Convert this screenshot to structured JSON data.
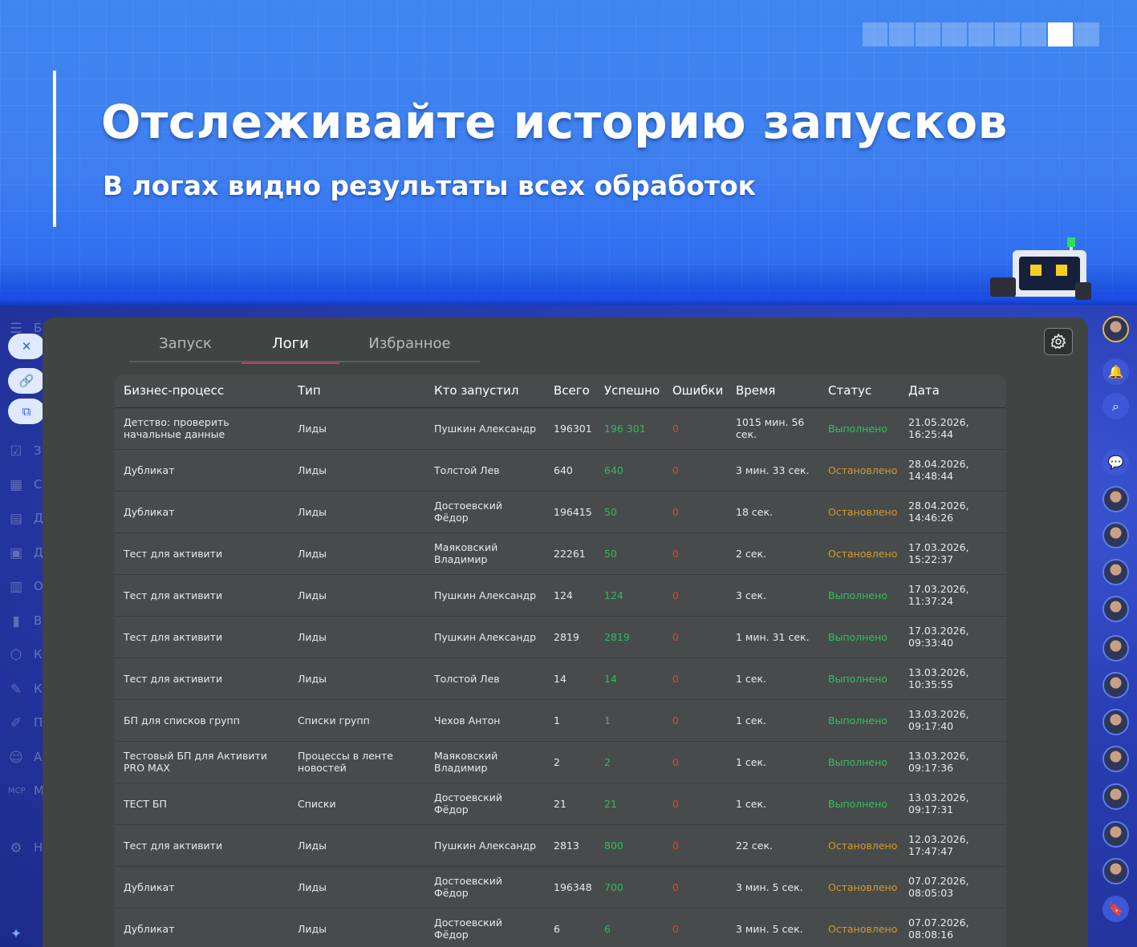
{
  "banner": {
    "title": "Отслеживайте историю запусков",
    "subtitle": "В логах видно результаты всех обработок",
    "page_dots": {
      "total": 9,
      "active_index": 7
    }
  },
  "tabs": [
    {
      "label": "Запуск",
      "active": false
    },
    {
      "label": "Логи",
      "active": true
    },
    {
      "label": "Избранное",
      "active": false
    }
  ],
  "table": {
    "columns": [
      "Бизнес-процесс",
      "Тип",
      "Кто запустил",
      "Всего",
      "Успешно",
      "Ошибки",
      "Время",
      "Статус",
      "Дата"
    ],
    "rows": [
      [
        "Детство: проверить начальные данные",
        "Лиды",
        "Пушкин Александр",
        "196301",
        "196 301",
        "0",
        "1015 мин. 56 сек.",
        "Выполнено",
        "21.05.2026, 16:25:44"
      ],
      [
        "Дубликат",
        "Лиды",
        "Толстой Лев",
        "640",
        "640",
        "0",
        "3 мин. 33 сек.",
        "Остановлено",
        "28.04.2026, 14:48:44"
      ],
      [
        "Дубликат",
        "Лиды",
        "Достоевский Фёдор",
        "196415",
        "50",
        "0",
        "18 сек.",
        "Остановлено",
        "28.04.2026, 14:46:26"
      ],
      [
        "Тест для активити",
        "Лиды",
        "Маяковский Владимир",
        "22261",
        "50",
        "0",
        "2 сек.",
        "Остановлено",
        "17.03.2026, 15:22:37"
      ],
      [
        "Тест для активити",
        "Лиды",
        "Пушкин Александр",
        "124",
        "124",
        "0",
        "3 сек.",
        "Выполнено",
        "17.03.2026, 11:37:24"
      ],
      [
        "Тест для активити",
        "Лиды",
        "Пушкин Александр",
        "2819",
        "2819",
        "0",
        "1 мин. 31 сек.",
        "Выполнено",
        "17.03.2026, 09:33:40"
      ],
      [
        "Тест для активити",
        "Лиды",
        "Толстой Лев",
        "14",
        "14",
        "0",
        "1 сек.",
        "Выполнено",
        "13.03.2026, 10:35:55"
      ],
      [
        "БП для списков групп",
        "Списки групп",
        "Чехов Антон",
        "1",
        "1",
        "0",
        "1 сек.",
        "Выполнено",
        "13.03.2026, 09:17:40"
      ],
      [
        "Тестовый БП для Активити PRO MAX",
        "Процессы в ленте новостей",
        "Маяковский Владимир",
        "2",
        "2",
        "0",
        "1 сек.",
        "Выполнено",
        "13.03.2026, 09:17:36"
      ],
      [
        "ТЕСТ БП",
        "Списки",
        "Достоевский Фёдор",
        "21",
        "21",
        "0",
        "1 сек.",
        "Выполнено",
        "13.03.2026, 09:17:31"
      ],
      [
        "Тест для активити",
        "Лиды",
        "Пушкин Александр",
        "2813",
        "800",
        "0",
        "22 сек.",
        "Остановлено",
        "12.03.2026, 17:47:47"
      ],
      [
        "Дубликат",
        "Лиды",
        "Достоевский Фёдор",
        "196348",
        "700",
        "0",
        "3 мин. 5 сек.",
        "Остановлено",
        "07.07.2026, 08:05:03"
      ],
      [
        "Дубликат",
        "Лиды",
        "Достоевский Фёдор",
        "6",
        "6",
        "0",
        "3 мин. 5 сек.",
        "Остановлено",
        "07.07.2026, 08:08:16"
      ]
    ]
  },
  "left_nav_letters": [
    "Б",
    "З",
    "С",
    "Д",
    "Д",
    "О",
    "В",
    "К",
    "К",
    "П",
    "А",
    "М",
    "Н"
  ],
  "left_nav_icons": [
    "menu-icon",
    "close-icon",
    "link-icon",
    "external-link-icon",
    "tasks-icon",
    "calendar-icon",
    "document-icon",
    "presentation-icon",
    "schedule-icon",
    "chart-icon",
    "hexagon-icon",
    "edit-doc-icon",
    "pen-icon",
    "robot-icon",
    "mcp-icon",
    "gear-icon"
  ],
  "colors": {
    "success": "#2fbd5c",
    "error": "#e0433c",
    "stopped": "#d49a2c",
    "active_tab": "#c23a64",
    "panel": "#404443",
    "banner": "#3f86f0"
  },
  "status_classes": {
    "Выполнено": "st-done",
    "Остановлено": "st-stop"
  }
}
